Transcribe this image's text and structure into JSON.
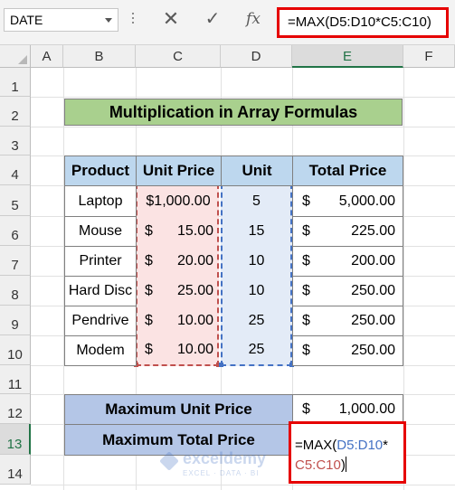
{
  "formula_bar": {
    "name_box": "DATE",
    "cancel_icon": "✕",
    "enter_icon": "✓",
    "fx_label": "fx",
    "formula": "=MAX(D5:D10*C5:C10)"
  },
  "columns": [
    "A",
    "B",
    "C",
    "D",
    "E",
    "F"
  ],
  "rows": [
    "1",
    "2",
    "3",
    "4",
    "5",
    "6",
    "7",
    "8",
    "9",
    "10",
    "11",
    "12",
    "13",
    "14"
  ],
  "title": "Multiplication in Array Formulas",
  "table": {
    "headers": [
      "Product",
      "Unit Price",
      "Unit",
      "Total Price"
    ],
    "rows": [
      {
        "product": "Laptop",
        "unit_price": "$1,000.00",
        "unit": "5",
        "total_sym": "$",
        "total": "5,000.00"
      },
      {
        "product": "Mouse",
        "unit_price_sym": "$",
        "unit_price": "15.00",
        "unit": "15",
        "total_sym": "$",
        "total": "225.00"
      },
      {
        "product": "Printer",
        "unit_price_sym": "$",
        "unit_price": "20.00",
        "unit": "10",
        "total_sym": "$",
        "total": "200.00"
      },
      {
        "product": "Hard Disc",
        "unit_price_sym": "$",
        "unit_price": "25.00",
        "unit": "10",
        "total_sym": "$",
        "total": "250.00"
      },
      {
        "product": "Pendrive",
        "unit_price_sym": "$",
        "unit_price": "10.00",
        "unit": "25",
        "total_sym": "$",
        "total": "250.00"
      },
      {
        "product": "Modem",
        "unit_price_sym": "$",
        "unit_price": "10.00",
        "unit": "25",
        "total_sym": "$",
        "total": "250.00"
      }
    ]
  },
  "summary": {
    "max_unit_label": "Maximum Unit Price",
    "max_unit_sym": "$",
    "max_unit_value": "1,000.00",
    "max_total_label": "Maximum Total Price"
  },
  "editing": {
    "prefix": "=MAX(",
    "ref1": "D5:D10",
    "op": "*",
    "ref2": "C5:C10",
    "suffix": ")"
  },
  "watermark": {
    "name": "exceldemy",
    "tagline": "EXCEL · DATA · BI"
  },
  "colors": {
    "ref1": "#4472c4",
    "ref2": "#c0504d",
    "highlight": "#e60000",
    "title_fill": "#a9d08e",
    "header_fill": "#bdd7ee",
    "summary_fill": "#b4c6e7",
    "selected_header": "#217346"
  }
}
